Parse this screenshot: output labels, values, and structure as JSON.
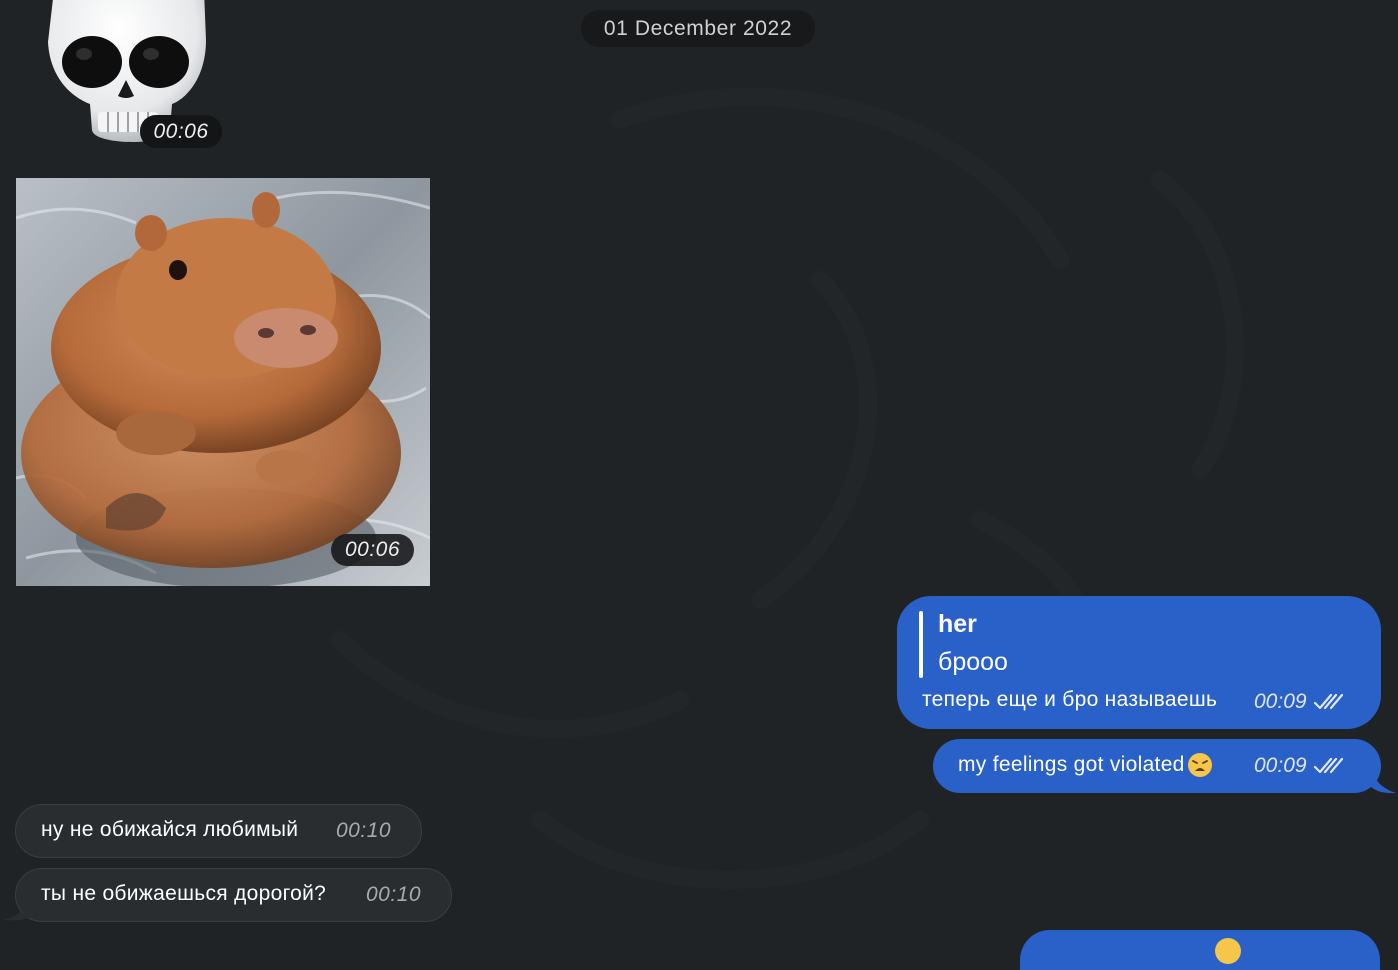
{
  "date_separator": "01 December 2022",
  "messages": {
    "sticker": {
      "emoji": "skull",
      "time": "00:06"
    },
    "photo": {
      "subject": "capybara",
      "time": "00:06"
    },
    "reply": {
      "quote_author": "her",
      "quote_text": "брооо",
      "text": "теперь еще и бро называешь",
      "time": "00:09",
      "status": "read"
    },
    "violated": {
      "text": "my feelings got violated",
      "emoji": "weary-face",
      "time": "00:09",
      "status": "read"
    },
    "incoming1": {
      "text": "ну не обижайся любимый",
      "time": "00:10"
    },
    "incoming2": {
      "text": "ты не обижаешься дорогой?",
      "time": "00:10"
    }
  },
  "colors": {
    "background": "#202325",
    "outgoing_bubble": "#2a61c8",
    "incoming_bubble": "#2a2d30"
  }
}
